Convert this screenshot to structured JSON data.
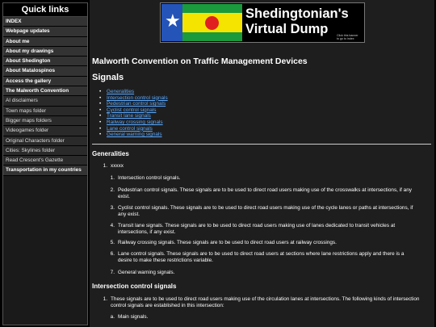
{
  "sidebar": {
    "title": "Quick links",
    "items": [
      {
        "label": "INDEX"
      },
      {
        "label": "Webpage updates"
      },
      {
        "label": "About me"
      },
      {
        "label": "About my drawings"
      },
      {
        "label": "About Shedington"
      },
      {
        "label": "About Matalospinos"
      },
      {
        "label": "Access the gallery"
      },
      {
        "label": "The Malworth Convention"
      },
      {
        "label": "AI disclaimers"
      },
      {
        "label": "Town maps folder"
      },
      {
        "label": "Bigger maps folders"
      },
      {
        "label": "Videogames folder"
      },
      {
        "label": "Original Characters folder"
      },
      {
        "label": "Cities: Skylines folder"
      },
      {
        "label": "Read Crescent's Gazette"
      },
      {
        "label": "Transportation in my countries"
      }
    ]
  },
  "banner": {
    "title_line1": "Shedingtonian's",
    "title_line2": "Virtual Dump",
    "back_hint": "Click this banner to go to index"
  },
  "page": {
    "title": "Malworth Convention on Traffic Management Devices",
    "section": "Signals",
    "toc": [
      "Generalities",
      "Intersection control signals",
      "Pedestrian control signals",
      "Cyclist control signals",
      "Transit lane signals",
      "Railway crossing signals",
      "Lane control signals",
      "General warning signals"
    ],
    "generalities": {
      "heading": "Generalities",
      "items": [
        {
          "num": "1.",
          "text": "xxxxx"
        },
        {
          "num": "1.",
          "text": "Intersection control signals."
        },
        {
          "num": "2.",
          "text_l1": "Pedestrian control signals. These signals are to be used to direct road users making use of the crosswalks at intersections, if any",
          "text_l2": "exist."
        },
        {
          "num": "3.",
          "text_l1": "Cyclist control signals. These signals are to be used to direct road users making use of the cycle lanes or paths at intersections, if",
          "text_l2": "any exist."
        },
        {
          "num": "4.",
          "text_l1": "Transit lane signals. These signals are to be used to direct road users making use of lanes dedicated to transit vehicles at",
          "text_l2": "intersections, if any exist."
        },
        {
          "num": "5.",
          "text": "Railway crossing signals. These signals are to be used to direct road users at railway crossings."
        },
        {
          "num": "6.",
          "text_l1": "Lane control signals. These signals are to be used to direct road users at sections where lane restrictions apply and there is a",
          "text_l2": "desire to make these restrictions variable."
        },
        {
          "num": "7.",
          "text": "General warning signals."
        }
      ]
    },
    "intersection": {
      "heading": "Intersection control signals",
      "item1_num": "1.",
      "item1_l1": "These signals are to be used to direct road users making use of the circulation lanes at intersections. The following kinds of intersection",
      "item1_l2": "control signals are established in this intersection:",
      "sub_a_num": "a.",
      "sub_a": "Main signals."
    }
  }
}
